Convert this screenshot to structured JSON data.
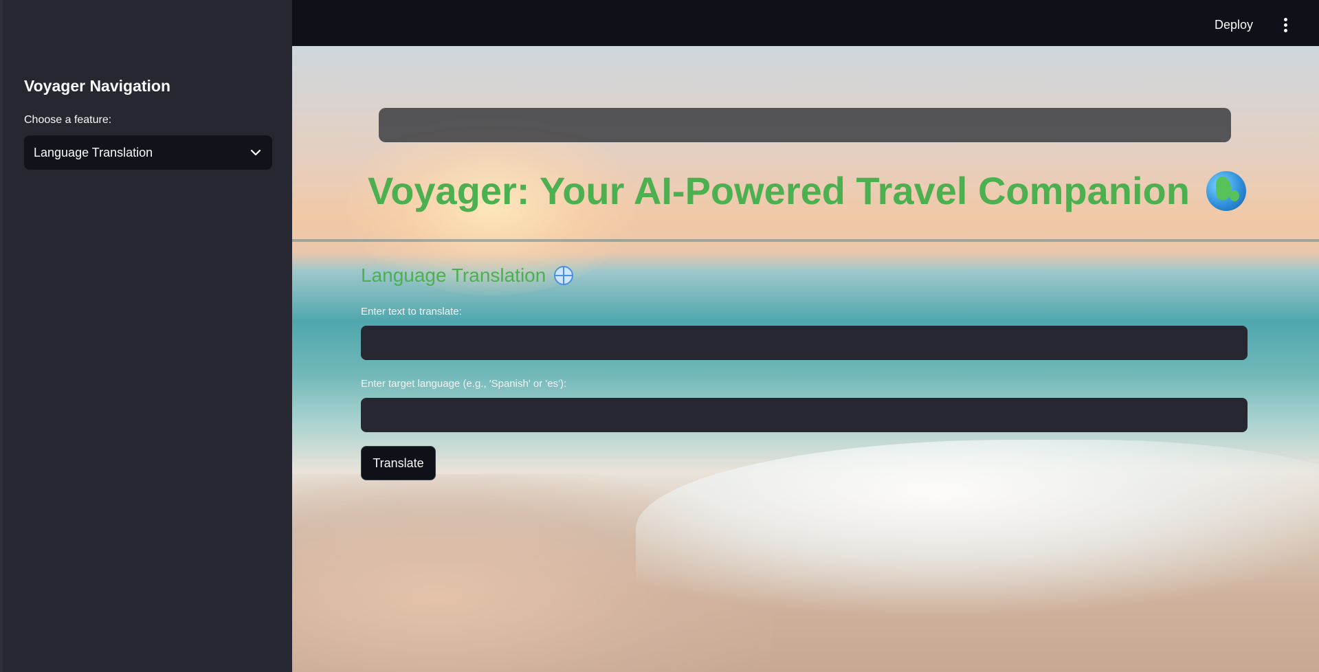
{
  "sidebar": {
    "title": "Voyager Navigation",
    "feature_label": "Choose a feature:",
    "selected_feature": "Language Translation"
  },
  "header": {
    "deploy_label": "Deploy"
  },
  "main": {
    "title": "Voyager: Your AI-Powered Travel Companion",
    "section_title": "Language Translation",
    "text_label": "Enter text to translate:",
    "text_value": "",
    "language_label": "Enter target language (e.g., 'Spanish' or 'es'):",
    "language_value": "",
    "translate_label": "Translate"
  },
  "icons": {
    "title_icon": "globe-earth-icon",
    "section_icon": "globe-meridians-icon",
    "select_icon": "chevron-down-icon",
    "menu_icon": "vertical-dots-icon"
  },
  "colors": {
    "accent_green": "#4caf50",
    "sidebar_bg": "#262730",
    "header_bg": "#0e1117",
    "input_bg": "#262730"
  }
}
